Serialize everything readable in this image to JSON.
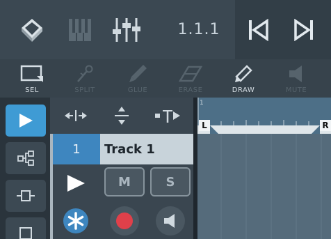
{
  "topbar": {
    "position": "1.1.1",
    "icons": [
      "browser-icon",
      "keyboard-icon",
      "mixer-icon",
      "return-to-start-icon",
      "play-icon"
    ]
  },
  "toolbar": {
    "tools": [
      {
        "id": "sel",
        "label": "SEL",
        "icon": "selection-icon",
        "enabled": true
      },
      {
        "id": "split",
        "label": "SPLIT",
        "icon": "scissors-icon",
        "enabled": false
      },
      {
        "id": "glue",
        "label": "GLUE",
        "icon": "glue-icon",
        "enabled": false
      },
      {
        "id": "erase",
        "label": "ERASE",
        "icon": "eraser-icon",
        "enabled": false
      },
      {
        "id": "draw",
        "label": "DRAW",
        "icon": "pencil-icon",
        "enabled": true
      },
      {
        "id": "mute",
        "label": "MUTE",
        "icon": "speaker-icon",
        "enabled": false
      }
    ]
  },
  "left_rail": {
    "buttons": [
      "play-icon",
      "routing-icon",
      "insert-icon",
      "square-icon"
    ]
  },
  "header_tools": [
    "width-resize-icon",
    "height-resize-icon",
    "track-add-icon"
  ],
  "track": {
    "number": "1",
    "name": "Track 1",
    "mute_label": "M",
    "solo_label": "S"
  },
  "ruler": {
    "bar_number": "1",
    "left_locator": "L",
    "right_locator": "R"
  },
  "colors": {
    "accent": "#3f9bd4",
    "record": "#e0404a"
  }
}
